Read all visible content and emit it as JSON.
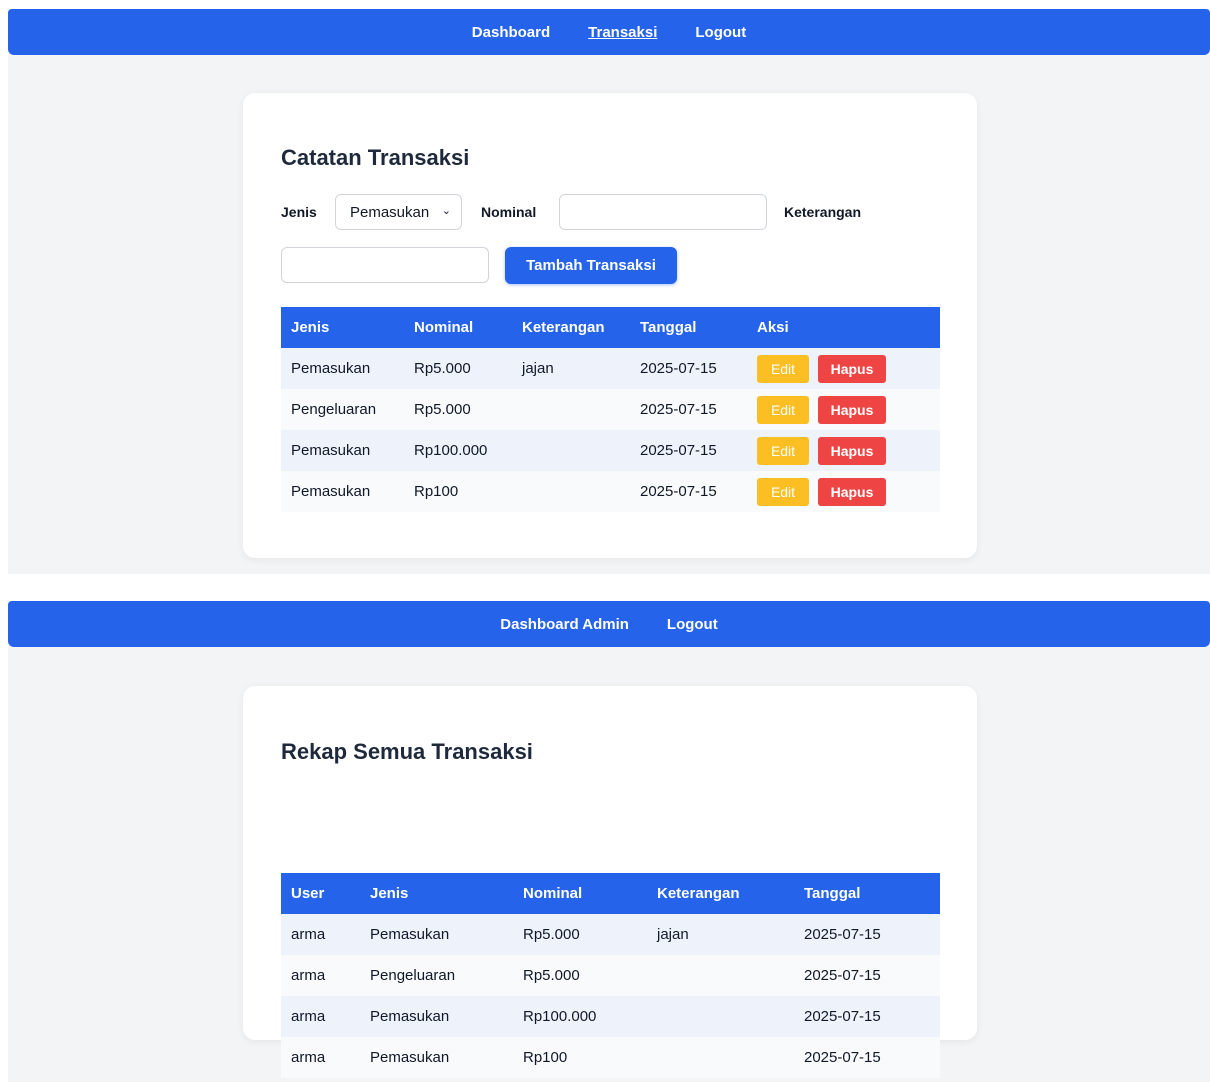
{
  "user_page": {
    "nav": [
      "Dashboard",
      "Transaksi",
      "Logout"
    ],
    "active_nav": "Transaksi",
    "title": "Catatan Transaksi",
    "form": {
      "jenis_label": "Jenis",
      "jenis_value": "Pemasukan",
      "nominal_label": "Nominal",
      "nominal_value": "",
      "keterangan_label": "Keterangan",
      "keterangan_value": "",
      "submit_label": "Tambah Transaksi"
    },
    "table": {
      "headers": [
        "Jenis",
        "Nominal",
        "Keterangan",
        "Tanggal",
        "Aksi"
      ],
      "rows": [
        [
          "Pemasukan",
          "Rp5.000",
          "jajan",
          "2025-07-15"
        ],
        [
          "Pengeluaran",
          "Rp5.000",
          "",
          "2025-07-15"
        ],
        [
          "Pemasukan",
          "Rp100.000",
          "",
          "2025-07-15"
        ],
        [
          "Pemasukan",
          "Rp100",
          "",
          "2025-07-15"
        ]
      ],
      "edit_label": "Edit",
      "delete_label": "Hapus"
    }
  },
  "admin_page": {
    "nav": [
      "Dashboard Admin",
      "Logout"
    ],
    "title": "Rekap Semua Transaksi",
    "table": {
      "headers": [
        "User",
        "Jenis",
        "Nominal",
        "Keterangan",
        "Tanggal"
      ],
      "rows": [
        [
          "arma",
          "Pemasukan",
          "Rp5.000",
          "jajan",
          "2025-07-15"
        ],
        [
          "arma",
          "Pengeluaran",
          "Rp5.000",
          "",
          "2025-07-15"
        ],
        [
          "arma",
          "Pemasukan",
          "Rp100.000",
          "",
          "2025-07-15"
        ],
        [
          "arma",
          "Pemasukan",
          "Rp100",
          "",
          "2025-07-15"
        ]
      ]
    }
  },
  "colors": {
    "primary": "#2563eb",
    "edit": "#fbbf24",
    "delete": "#ef4444",
    "background": "#f3f4f6"
  }
}
